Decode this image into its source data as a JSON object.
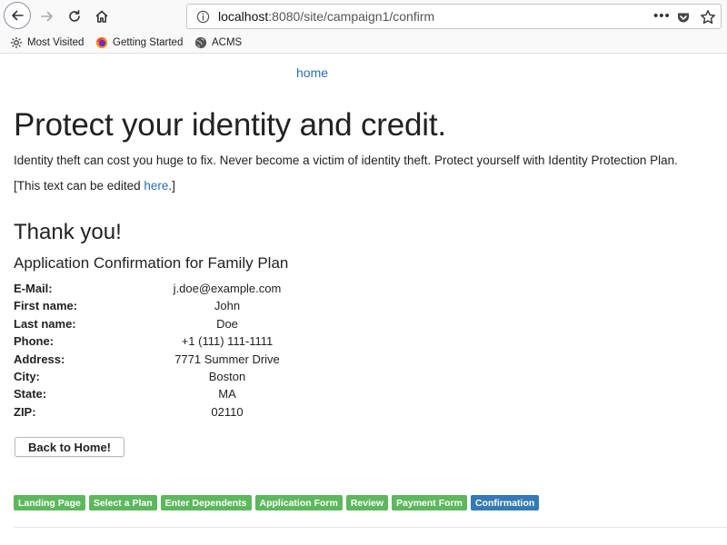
{
  "browser": {
    "url_host": "localhost",
    "url_rest": ":8080/site/campaign1/confirm",
    "more_label": "•••",
    "bookmarks": [
      {
        "label": "Most Visited"
      },
      {
        "label": "Getting Started"
      },
      {
        "label": "ACMS"
      }
    ]
  },
  "page": {
    "home_link": "home",
    "headline": "Protect your identity and credit.",
    "intro": "Identity theft can cost you huge to fix. Never become a victim of identity theft. Protect yourself with Identity Protection Plan.",
    "editable_prefix": "[This text can be edited ",
    "editable_link": "here",
    "editable_suffix": ".]",
    "thanks": "Thank you!",
    "subheading": "Application Confirmation for Family Plan",
    "fields": [
      {
        "label": "E-Mail:",
        "value": "j.doe@example.com"
      },
      {
        "label": "First name:",
        "value": "John"
      },
      {
        "label": "Last name:",
        "value": "Doe"
      },
      {
        "label": "Phone:",
        "value": "+1 (111) 111-1111"
      },
      {
        "label": "Address:",
        "value": "7771 Summer Drive"
      },
      {
        "label": "City:",
        "value": "Boston"
      },
      {
        "label": "State:",
        "value": "MA"
      },
      {
        "label": "ZIP:",
        "value": "02110"
      }
    ],
    "back_button": "Back to Home!",
    "steps": [
      {
        "label": "Landing Page",
        "active": false
      },
      {
        "label": "Select a Plan",
        "active": false
      },
      {
        "label": "Enter Dependents",
        "active": false
      },
      {
        "label": "Application Form",
        "active": false
      },
      {
        "label": "Review",
        "active": false
      },
      {
        "label": "Payment Form",
        "active": false
      },
      {
        "label": "Confirmation",
        "active": true
      }
    ]
  },
  "colors": {
    "link": "#2a6db5",
    "step_done": "#5cb85c",
    "step_active": "#337ab7"
  }
}
